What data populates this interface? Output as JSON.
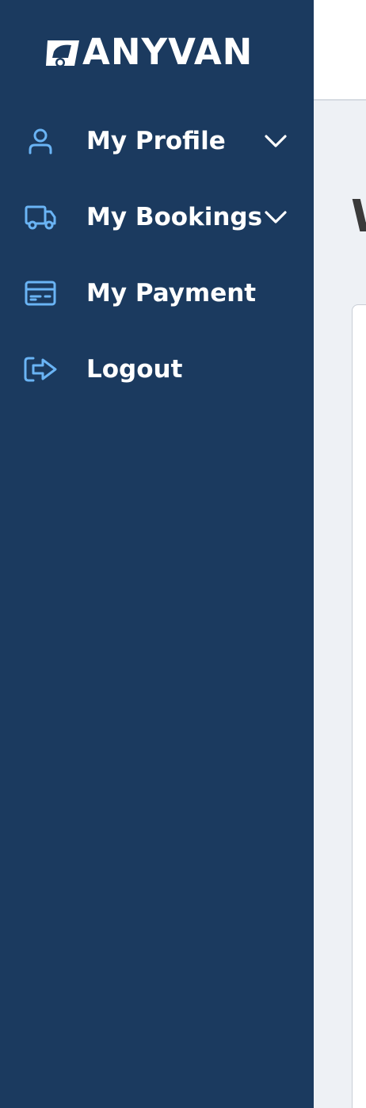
{
  "brand": {
    "name": "ANYVAN"
  },
  "sidebar": {
    "items": [
      {
        "label": "My Profile",
        "icon": "user-icon",
        "has_chevron": true
      },
      {
        "label": "My Bookings",
        "icon": "truck-icon",
        "has_chevron": true
      },
      {
        "label": "My Payment",
        "icon": "credit-card-icon",
        "has_chevron": false
      },
      {
        "label": "Logout",
        "icon": "logout-icon",
        "has_chevron": false
      }
    ]
  },
  "main": {
    "heading_partial": "W"
  },
  "colors": {
    "sidebar_bg": "#1b3a5f",
    "icon_accent": "#6ab4f5",
    "text_on_sidebar": "#ffffff",
    "page_bg": "#eef1f5"
  }
}
